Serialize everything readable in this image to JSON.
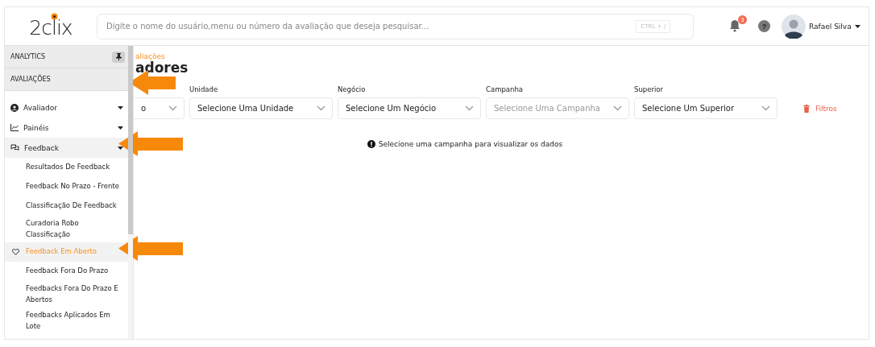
{
  "header": {
    "logo": "2clix",
    "search": {
      "placeholder": "Digite o nome do usuário,menu ou número da avaliação que deseja pesquisar...",
      "shortcut": "CTRL + /"
    },
    "notifications": {
      "count": "3"
    },
    "help": "?",
    "user": {
      "name": "Rafael Silva"
    }
  },
  "sidebar": {
    "sections": [
      {
        "label": "ANALYTICS",
        "pin": true
      },
      {
        "label": "AVALIAÇÕES",
        "pin": false
      }
    ],
    "items": [
      {
        "label": "Avaliador",
        "kind": "user",
        "expanded": false
      },
      {
        "label": "Painéis",
        "kind": "chart",
        "expanded": false
      },
      {
        "label": "Feedback",
        "kind": "chat",
        "expanded": true,
        "children": [
          {
            "label": "Resultados De Feedback",
            "selected": false
          },
          {
            "label": "Feedback No Prazo - Frente",
            "selected": false
          },
          {
            "label": "Classificação De Feedback",
            "selected": false
          },
          {
            "label": "Curadoria Robo Classificação",
            "selected": false
          },
          {
            "label": "Feedback Em Aberto",
            "selected": true
          },
          {
            "label": "Feedback Fora Do Prazo",
            "selected": false
          },
          {
            "label": "Feedbacks Fora Do Prazo E Abertos",
            "selected": false
          },
          {
            "label": "Feedbacks Aplicados Em Lote",
            "selected": false
          }
        ]
      }
    ]
  },
  "content": {
    "breadcrumb": "aliações",
    "title": "adores",
    "filters": [
      {
        "placeholder": "o",
        "disabled": false
      },
      {
        "label": "Unidade",
        "placeholder": "Selecione Uma Unidade",
        "disabled": false
      },
      {
        "label": "Negócio",
        "placeholder": "Selecione Um Negócio",
        "disabled": false
      },
      {
        "label": "Campanha",
        "placeholder": "Selecione Uma Campanha",
        "disabled": true
      },
      {
        "label": "Superior",
        "placeholder": "Selecione Um Superior",
        "disabled": false
      }
    ],
    "clear_button": "Filtros",
    "message": "Selecione uma campanha para visualizar os dados"
  }
}
